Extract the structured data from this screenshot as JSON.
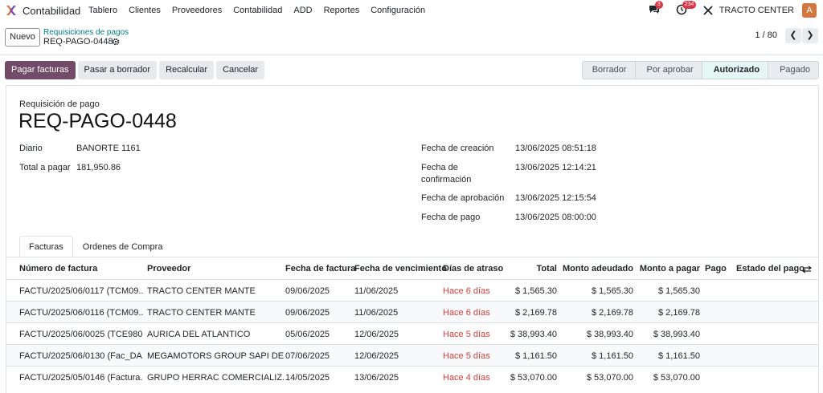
{
  "app": {
    "name": "Contabilidad",
    "logo_icon": "odoo-accounting-icon"
  },
  "menu": [
    "Tablero",
    "Clientes",
    "Proveedores",
    "Contabilidad",
    "ADD",
    "Reportes",
    "Configuración"
  ],
  "systray": {
    "messages_badge": "3",
    "activities_badge": "234",
    "company": "TRACTO CENTER",
    "avatar_letter": "A"
  },
  "control": {
    "new_label": "Nuevo",
    "breadcrumb_parent": "Requisiciones de pagos",
    "breadcrumb_current": "REQ-PAGO-0448",
    "pager": "1 / 80",
    "prev": "❮",
    "next": "❯"
  },
  "actions": [
    "Pagar facturas",
    "Pasar a borrador",
    "Recalcular",
    "Cancelar"
  ],
  "stages": {
    "items": [
      "Borrador",
      "Por aprobar",
      "Autorizado",
      "Pagado"
    ],
    "active": "Autorizado"
  },
  "form": {
    "title_label": "Requisición de pago",
    "title": "REQ-PAGO-0448",
    "left": [
      {
        "label": "Diario",
        "value": "BANORTE 1161"
      },
      {
        "label": "Total a pagar",
        "value": "181,950.86"
      }
    ],
    "right": [
      {
        "label": "Fecha de creación",
        "value": "13/06/2025 08:51:18"
      },
      {
        "label": "Fecha de confirmación",
        "value": "13/06/2025 12:14:21"
      },
      {
        "label": "Fecha de aprobación",
        "value": "13/06/2025 12:15:54"
      },
      {
        "label": "Fecha de pago",
        "value": "13/06/2025 08:00:00"
      }
    ]
  },
  "tabs": [
    "Facturas",
    "Ordenes de Compra"
  ],
  "table": {
    "headers": [
      "Número de factura",
      "Proveedor",
      "Fecha de factura",
      "Fecha de vencimiento",
      "Días de atraso",
      "Total",
      "Monto adeudado",
      "Monto a pagar",
      "Pago",
      "Estado del pago"
    ],
    "rows": [
      [
        "FACTU/2025/06/0117 (TCM09...",
        "TRACTO CENTER MANTE",
        "09/06/2025",
        "11/06/2025",
        "Hace 6 días",
        "$ 1,565.30",
        "$ 1,565.30",
        "$ 1,565.30"
      ],
      [
        "FACTU/2025/06/0116 (TCM09...",
        "TRACTO CENTER MANTE",
        "09/06/2025",
        "11/06/2025",
        "Hace 6 días",
        "$ 2,169.78",
        "$ 2,169.78",
        "$ 2,169.78"
      ],
      [
        "FACTU/2025/06/0025 (TCE980...",
        "AURICA DEL ATLANTICO",
        "05/06/2025",
        "12/06/2025",
        "Hace 5 días",
        "$ 38,993.40",
        "$ 38,993.40",
        "$ 38,993.40"
      ],
      [
        "FACTU/2025/06/0130 (Fac_DA...",
        "MEGAMOTORS GROUP SAPI DE CV",
        "07/06/2025",
        "12/06/2025",
        "Hace 5 días",
        "$ 1,161.50",
        "$ 1,161.50",
        "$ 1,161.50"
      ],
      [
        "FACTU/2025/05/0146 (Factura...",
        "GRUPO HERRAC COMERCIALIZ...",
        "14/05/2025",
        "13/06/2025",
        "Hace 4 días",
        "$ 53,070.00",
        "$ 53,070.00",
        "$ 53,070.00"
      ]
    ]
  },
  "colors": {
    "primary": "#714b67",
    "link": "#017e84",
    "overdue": "#d23f3a",
    "badge": "#dc3545"
  }
}
